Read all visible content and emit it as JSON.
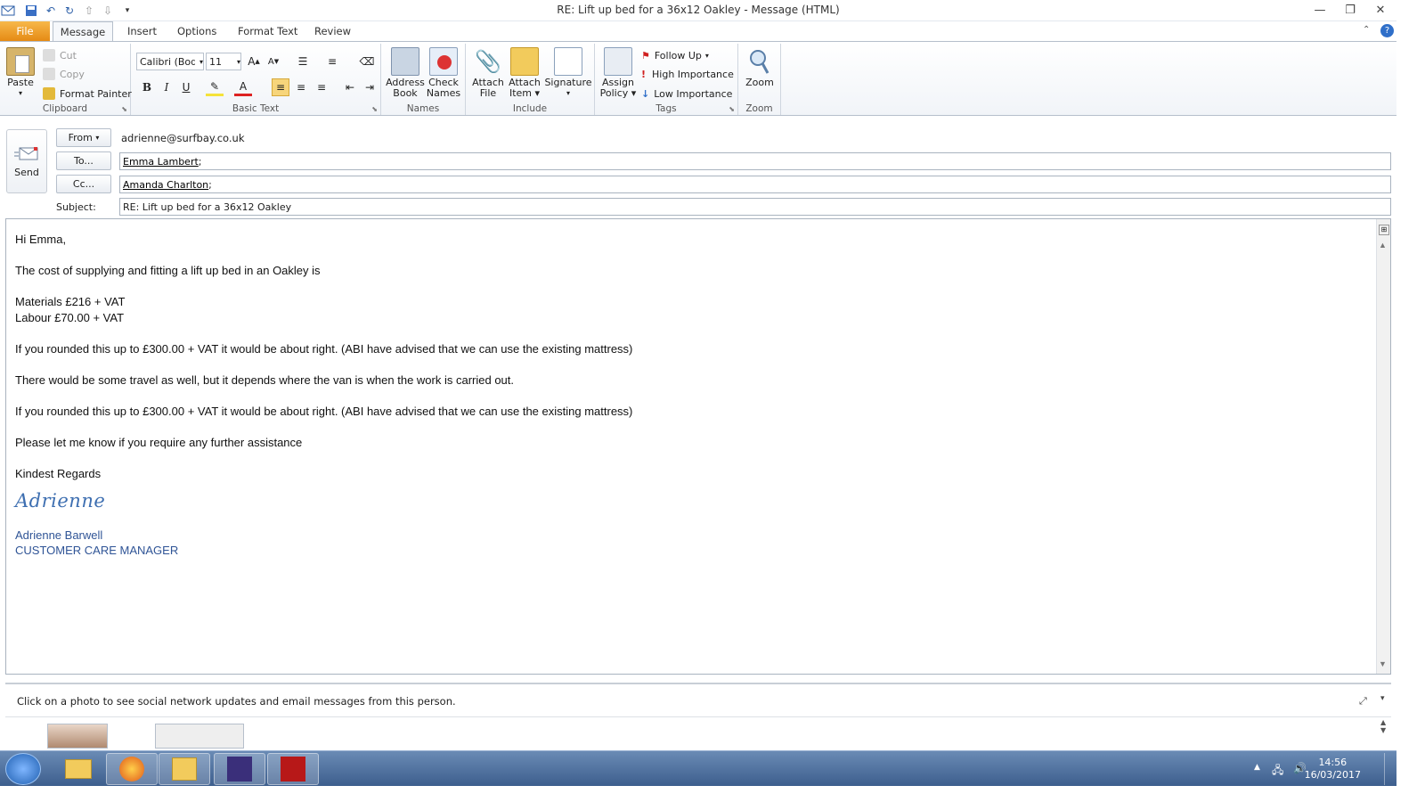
{
  "window": {
    "title": "RE: Lift up bed for a 36x12 Oakley  -  Message (HTML)"
  },
  "tabs": [
    {
      "label": "File"
    },
    {
      "label": "Message"
    },
    {
      "label": "Insert"
    },
    {
      "label": "Options"
    },
    {
      "label": "Format Text"
    },
    {
      "label": "Review"
    }
  ],
  "ribbon": {
    "clipboard": {
      "paste": "Paste",
      "cut": "Cut",
      "copy": "Copy",
      "format_painter": "Format Painter",
      "group": "Clipboard"
    },
    "basic_text": {
      "font": "Calibri (Body)",
      "size": "11",
      "group": "Basic Text"
    },
    "names": {
      "address_book_1": "Address",
      "address_book_2": "Book",
      "check_names_1": "Check",
      "check_names_2": "Names",
      "group": "Names"
    },
    "include": {
      "attach_file_1": "Attach",
      "attach_file_2": "File",
      "attach_item_1": "Attach",
      "attach_item_2": "Item",
      "signature": "Signature",
      "group": "Include"
    },
    "tags": {
      "assign_policy_1": "Assign",
      "assign_policy_2": "Policy",
      "follow_up": "Follow Up",
      "high_importance": "High Importance",
      "low_importance": "Low Importance",
      "group": "Tags"
    },
    "zoom": {
      "zoom": "Zoom",
      "group": "Zoom"
    }
  },
  "header": {
    "send": "Send",
    "from_btn": "From",
    "from_value": "adrienne@surfbay.co.uk",
    "to_btn": "To...",
    "to_value": "Emma Lambert",
    "cc_btn": "Cc...",
    "cc_value": "Amanda Charlton",
    "subject_label": "Subject:",
    "subject_value": "RE: Lift up bed for a 36x12 Oakley"
  },
  "body": {
    "greeting": "Hi Emma,",
    "p1": "The cost of supplying and fitting a lift up bed in an Oakley is",
    "materials": "Materials £216 + VAT",
    "labour": "Labour £70.00 + VAT",
    "p2": "If you rounded this up to £300.00 + VAT it would be about right.  (ABI have advised that we can use the existing mattress)",
    "p3": "There would be some travel as well, but it depends where the van is when the work is carried out.",
    "p4": "If you rounded this up to £300.00 + VAT it would be about right.  (ABI have advised that we can use the existing mattress)",
    "p5": "Please let me know if you require any further assistance",
    "closing": "Kindest Regards",
    "signature_script": "Adrienne",
    "signature_name": "Adrienne Barwell",
    "signature_title": "CUSTOMER CARE MANAGER"
  },
  "people_pane": {
    "label": "Click on a photo to see social network updates and email messages from this person."
  },
  "taskbar": {
    "time": "14:56",
    "date": "16/03/2017"
  },
  "colors": {
    "file_tab": "#e58a14",
    "signature": "#2f5496",
    "taskbar": "#3d5e8d"
  }
}
